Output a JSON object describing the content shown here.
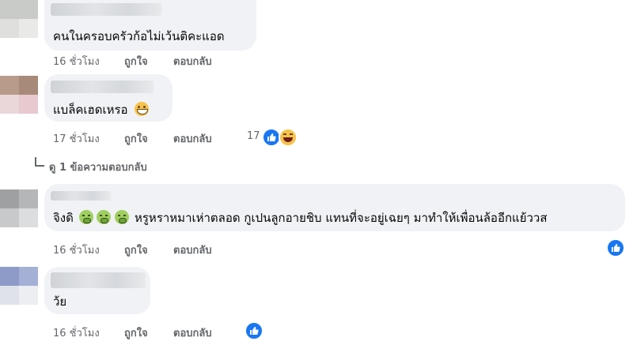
{
  "comments": [
    {
      "text": "คนในครอบครัวก้อไม่เว้นติคะแอด",
      "time": "16 ชั่วโมง",
      "like_label": "ถูกใจ",
      "reply_label": "ตอบกลับ"
    },
    {
      "text": "แบล็คเฮดเหรอ",
      "time": "17 ชั่วโมง",
      "like_label": "ถูกใจ",
      "reply_label": "ตอบกลับ",
      "reaction_count": "17",
      "view_replies_label": "ดู 1 ข้อความตอบกลับ"
    },
    {
      "text_before": "จิงดิ",
      "text_after": "หรูหราหมาเห่าตลอด กูเปนลูกอายชิบ แทนที่จะอยู่เฉยๆ มาทำให้เพื่อนล้ออีกแย้ววส",
      "time": "16 ชั่วโมง",
      "like_label": "ถูกใจ",
      "reply_label": "ตอบกลับ"
    },
    {
      "text": "ว้ย",
      "time": "16 ชั่วโมง",
      "like_label": "ถูกใจ",
      "reply_label": "ตอบกลับ"
    }
  ],
  "colors": {
    "bubble": "#f0f2f5",
    "meta": "#65676b",
    "like_blue": "#1877f2"
  },
  "icons": [
    "grin-emoji-icon",
    "sick-face-emoji-icon",
    "like-reaction-icon",
    "haha-reaction-icon",
    "reply-arrow-icon"
  ]
}
